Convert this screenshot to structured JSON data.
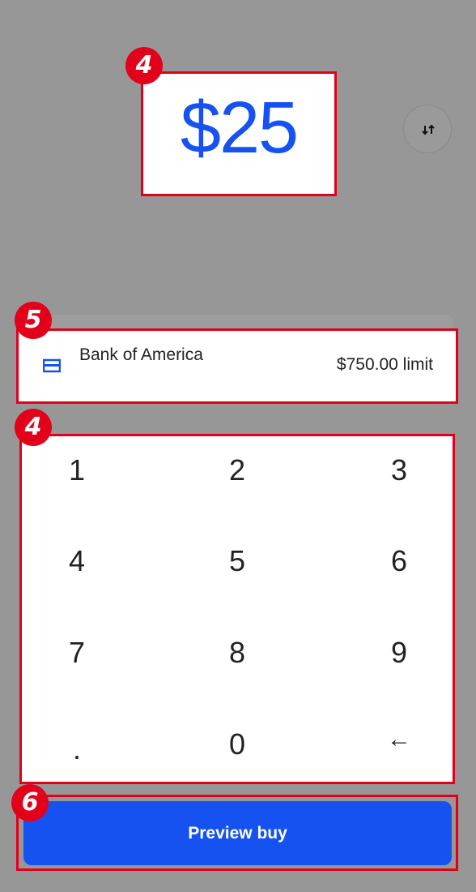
{
  "amount": {
    "value": "$25"
  },
  "annotations": {
    "amount_badge": "4",
    "payment_badge": "5",
    "keypad_badge": "4",
    "cta_badge": "6"
  },
  "payment": {
    "bank_name": "Bank of America",
    "limit": "$750.00 limit",
    "icon": "bank-card-icon"
  },
  "keypad": {
    "keys": [
      "1",
      "2",
      "3",
      "4",
      "5",
      "6",
      "7",
      "8",
      "9",
      ".",
      "0",
      "←"
    ]
  },
  "cta": {
    "label": "Preview buy"
  },
  "icons": {
    "swap": "swap-arrows-icon"
  },
  "colors": {
    "accent": "#1652f0",
    "highlight": "#e3001b",
    "overlay": "#979797"
  }
}
